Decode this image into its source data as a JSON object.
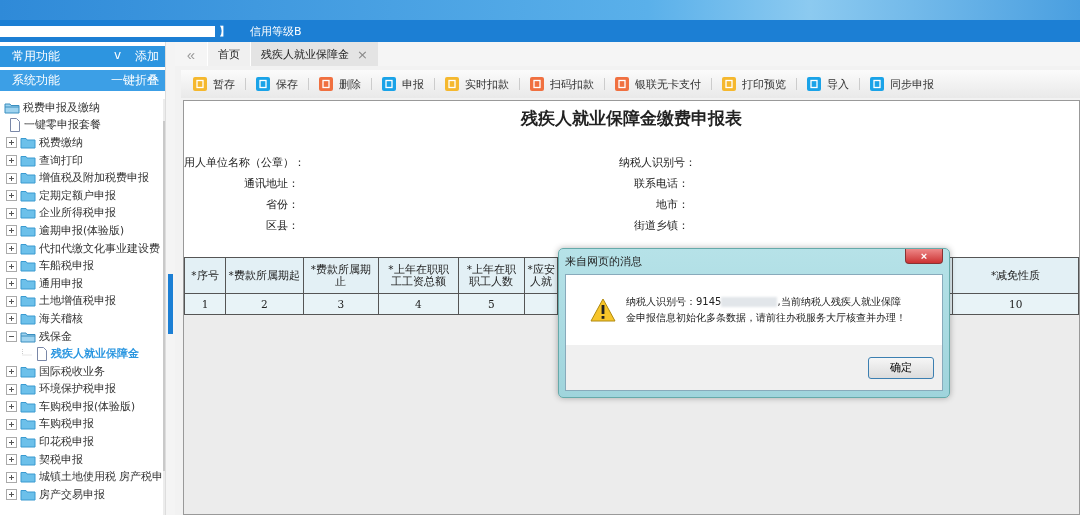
{
  "header": {
    "bracket": "】",
    "credit_rating": "信用等级B"
  },
  "sidebar": {
    "sections": [
      {
        "label": "常用功能",
        "toggle": "v",
        "action": "添加"
      },
      {
        "label": "系统功能",
        "action": "一键折叠"
      }
    ],
    "tree": [
      {
        "label": "税费申报及缴纳",
        "kind": "folder",
        "expanded": true,
        "selected": false,
        "children": [
          {
            "label": "一键零申报套餐",
            "kind": "file",
            "selected": false
          },
          {
            "label": "税费缴纳",
            "kind": "folder",
            "expanded": false,
            "selected": false
          },
          {
            "label": "查询打印",
            "kind": "folder",
            "expanded": false,
            "selected": false
          },
          {
            "label": "增值税及附加税费申报",
            "kind": "folder",
            "expanded": false,
            "selected": false
          },
          {
            "label": "定期定额户申报",
            "kind": "folder",
            "expanded": false,
            "selected": false
          },
          {
            "label": "企业所得税申报",
            "kind": "folder",
            "expanded": false,
            "selected": false
          },
          {
            "label": "逾期申报(体验版)",
            "kind": "folder",
            "expanded": false,
            "selected": false
          },
          {
            "label": "代扣代缴文化事业建设费",
            "kind": "folder",
            "expanded": false,
            "selected": false
          },
          {
            "label": "车船税申报",
            "kind": "folder",
            "expanded": false,
            "selected": false
          },
          {
            "label": "通用申报",
            "kind": "folder",
            "expanded": false,
            "selected": false
          },
          {
            "label": "土地增值税申报",
            "kind": "folder",
            "expanded": false,
            "selected": false
          },
          {
            "label": "海关稽核",
            "kind": "folder",
            "expanded": false,
            "selected": false
          },
          {
            "label": "残保金",
            "kind": "folder",
            "expanded": true,
            "selected": false,
            "children": [
              {
                "label": "残疾人就业保障金",
                "kind": "file",
                "selected": true
              }
            ]
          },
          {
            "label": "国际税收业务",
            "kind": "folder",
            "expanded": false,
            "selected": false
          },
          {
            "label": "环境保护税申报",
            "kind": "folder",
            "expanded": false,
            "selected": false
          },
          {
            "label": "车购税申报(体验版)",
            "kind": "folder",
            "expanded": false,
            "selected": false
          },
          {
            "label": "车购税申报",
            "kind": "folder",
            "expanded": false,
            "selected": false
          },
          {
            "label": "印花税申报",
            "kind": "folder",
            "expanded": false,
            "selected": false
          },
          {
            "label": "契税申报",
            "kind": "folder",
            "expanded": false,
            "selected": false
          },
          {
            "label": "城镇土地使用税 房产税申",
            "kind": "folder",
            "expanded": false,
            "selected": false
          },
          {
            "label": "房产交易申报",
            "kind": "folder",
            "expanded": false,
            "selected": false
          }
        ]
      }
    ]
  },
  "tabs": [
    {
      "label": "首页",
      "selected": false,
      "closable": false
    },
    {
      "label": "残疾人就业保障金",
      "selected": true,
      "closable": true,
      "close": "×"
    }
  ],
  "collapse_button": "«",
  "toolbar": [
    {
      "label": "暂存",
      "color": "#f5b82e"
    },
    {
      "label": "保存",
      "color": "#1aa3e8"
    },
    {
      "label": "删除",
      "color": "#f07040"
    },
    {
      "label": "申报",
      "color": "#1aa3e8"
    },
    {
      "label": "实时扣款",
      "color": "#f5b82e"
    },
    {
      "label": "扫码扣款",
      "color": "#f07040"
    },
    {
      "label": "银联无卡支付",
      "color": "#f07040"
    },
    {
      "label": "打印预览",
      "color": "#f5b82e"
    },
    {
      "label": "导入",
      "color": "#1aa3e8"
    },
    {
      "label": "同步申报",
      "color": "#1aa3e8"
    }
  ],
  "form": {
    "title": "残疾人就业保障金缴费申报表",
    "fields": [
      {
        "left": "用人单位名称（公章）：",
        "right": "纳税人识别号："
      },
      {
        "left": "通讯地址：",
        "right": "联系电话："
      },
      {
        "left": "省份：",
        "right": "地市："
      },
      {
        "left": "区县：",
        "right": "街道乡镇："
      }
    ],
    "table": {
      "columns": [
        "*序号",
        "*费款所属期起",
        "*费款所属期止",
        "*上年在职职工工资总额",
        "*上年在职职工人数",
        "*应安人就",
        "",
        "*减免性质"
      ],
      "rows": [
        [
          "1",
          "2",
          "3",
          "4",
          "5",
          "",
          "",
          "10"
        ]
      ]
    }
  },
  "dialog": {
    "title": "来自网页的消息",
    "close": "×",
    "message_start": "纳税人识别号：9145",
    "message_rest": ",当前纳税人残疾人就业保障",
    "message_line_2": "金申报信息初始化多条数据，请前往办税服务大厅核查并办理！",
    "ok_button": "确定"
  }
}
